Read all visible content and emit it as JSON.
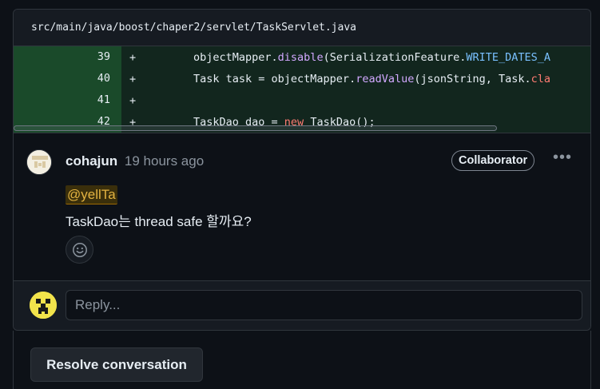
{
  "file": {
    "path": "src/main/java/boost/chaper2/servlet/TaskServlet.java"
  },
  "diff": {
    "lines": [
      {
        "number": "39",
        "sign": "+",
        "parts": [
          {
            "t": "objectMapper.",
            "c": ""
          },
          {
            "t": "disable",
            "c": "tk-fn"
          },
          {
            "t": "(SerializationFeature.",
            "c": ""
          },
          {
            "t": "WRITE_DATES_A",
            "c": "tk-const"
          }
        ]
      },
      {
        "number": "40",
        "sign": "+",
        "parts": [
          {
            "t": "Task task = objectMapper.",
            "c": ""
          },
          {
            "t": "readValue",
            "c": "tk-fn"
          },
          {
            "t": "(jsonString, Task.",
            "c": ""
          },
          {
            "t": "cla",
            "c": "tk-kw"
          }
        ]
      },
      {
        "number": "41",
        "sign": "+",
        "parts": []
      },
      {
        "number": "42",
        "sign": "+",
        "parts": [
          {
            "t": "TaskDao dao = ",
            "c": ""
          },
          {
            "t": "new",
            "c": "tk-kw"
          },
          {
            "t": " TaskDao();",
            "c": ""
          }
        ]
      }
    ]
  },
  "comment": {
    "author": "cohajun",
    "timestamp": "19 hours ago",
    "badge": "Collaborator",
    "more_icon": "kebab-horizontal-icon",
    "mention": "@yellTa",
    "body": "TaskDao는 thread safe 할까요?",
    "reaction_icon": "smiley-icon"
  },
  "reply": {
    "placeholder": "Reply..."
  },
  "actions": {
    "resolve_label": "Resolve conversation"
  },
  "colors": {
    "diff_added_bg": "#12261e",
    "diff_gutter_bg": "#1a4a2a",
    "mention_fg": "#e3b341"
  }
}
